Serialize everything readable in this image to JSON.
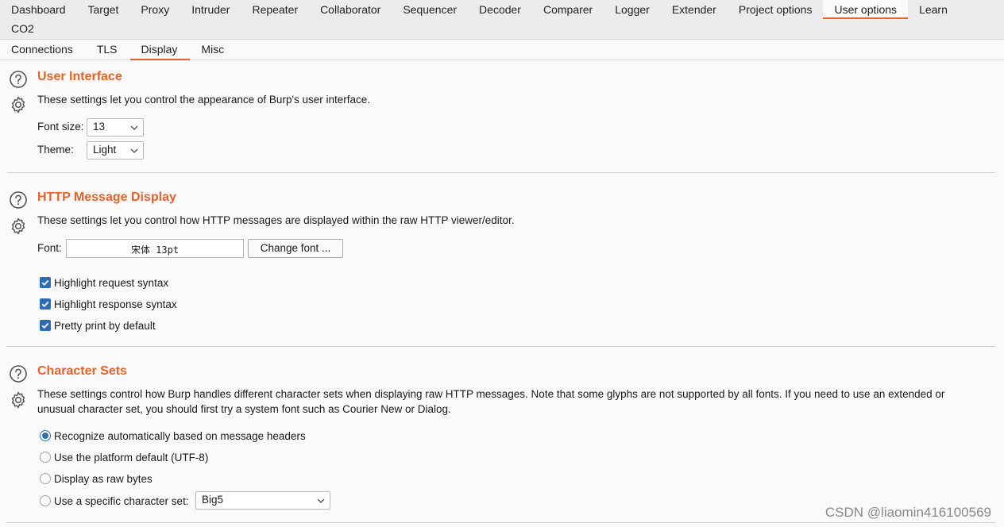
{
  "top_tabs_row1": [
    {
      "label": "Dashboard"
    },
    {
      "label": "Target"
    },
    {
      "label": "Proxy"
    },
    {
      "label": "Intruder"
    },
    {
      "label": "Repeater"
    },
    {
      "label": "Collaborator"
    },
    {
      "label": "Sequencer"
    },
    {
      "label": "Decoder"
    },
    {
      "label": "Comparer"
    },
    {
      "label": "Logger"
    },
    {
      "label": "Extender"
    },
    {
      "label": "Project options"
    },
    {
      "label": "User options",
      "active": true
    },
    {
      "label": "Learn"
    }
  ],
  "top_tabs_row2": [
    {
      "label": "CO2"
    }
  ],
  "sub_tabs": [
    {
      "label": "Connections"
    },
    {
      "label": "TLS"
    },
    {
      "label": "Display",
      "active": true
    },
    {
      "label": "Misc"
    }
  ],
  "user_interface": {
    "title": "User Interface",
    "description": "These settings let you control the appearance of Burp's user interface.",
    "font_size_label": "Font size:",
    "font_size_value": "13",
    "theme_label": "Theme:",
    "theme_value": "Light"
  },
  "http_display": {
    "title": "HTTP Message Display",
    "description": "These settings let you control how HTTP messages are displayed within the raw HTTP viewer/editor.",
    "font_label": "Font:",
    "font_value": "宋体 13pt",
    "change_font_label": "Change font ...",
    "checkboxes": [
      {
        "label": "Highlight request syntax",
        "checked": true
      },
      {
        "label": "Highlight response syntax",
        "checked": true
      },
      {
        "label": "Pretty print by default",
        "checked": true
      }
    ]
  },
  "character_sets": {
    "title": "Character Sets",
    "description": "These settings control how Burp handles different character sets when displaying raw HTTP messages. Note that some glyphs are not supported by all fonts. If you need to use an extended or unusual character set, you should first try a system font such as Courier New or Dialog.",
    "options": [
      {
        "label": "Recognize automatically based on message headers",
        "selected": true
      },
      {
        "label": "Use the platform default (UTF-8)",
        "selected": false
      },
      {
        "label": "Display as raw bytes",
        "selected": false
      },
      {
        "label": "Use a specific character set:",
        "selected": false
      }
    ],
    "charset_value": "Big5"
  },
  "icons": {
    "help": "help-circle-icon",
    "settings": "gear-icon",
    "dropdown": "chevron-down-icon",
    "check": "check-icon"
  },
  "colors": {
    "accent": "#e8622a",
    "check_blue": "#2f6db3"
  },
  "watermark": "CSDN @liaomin416100569"
}
